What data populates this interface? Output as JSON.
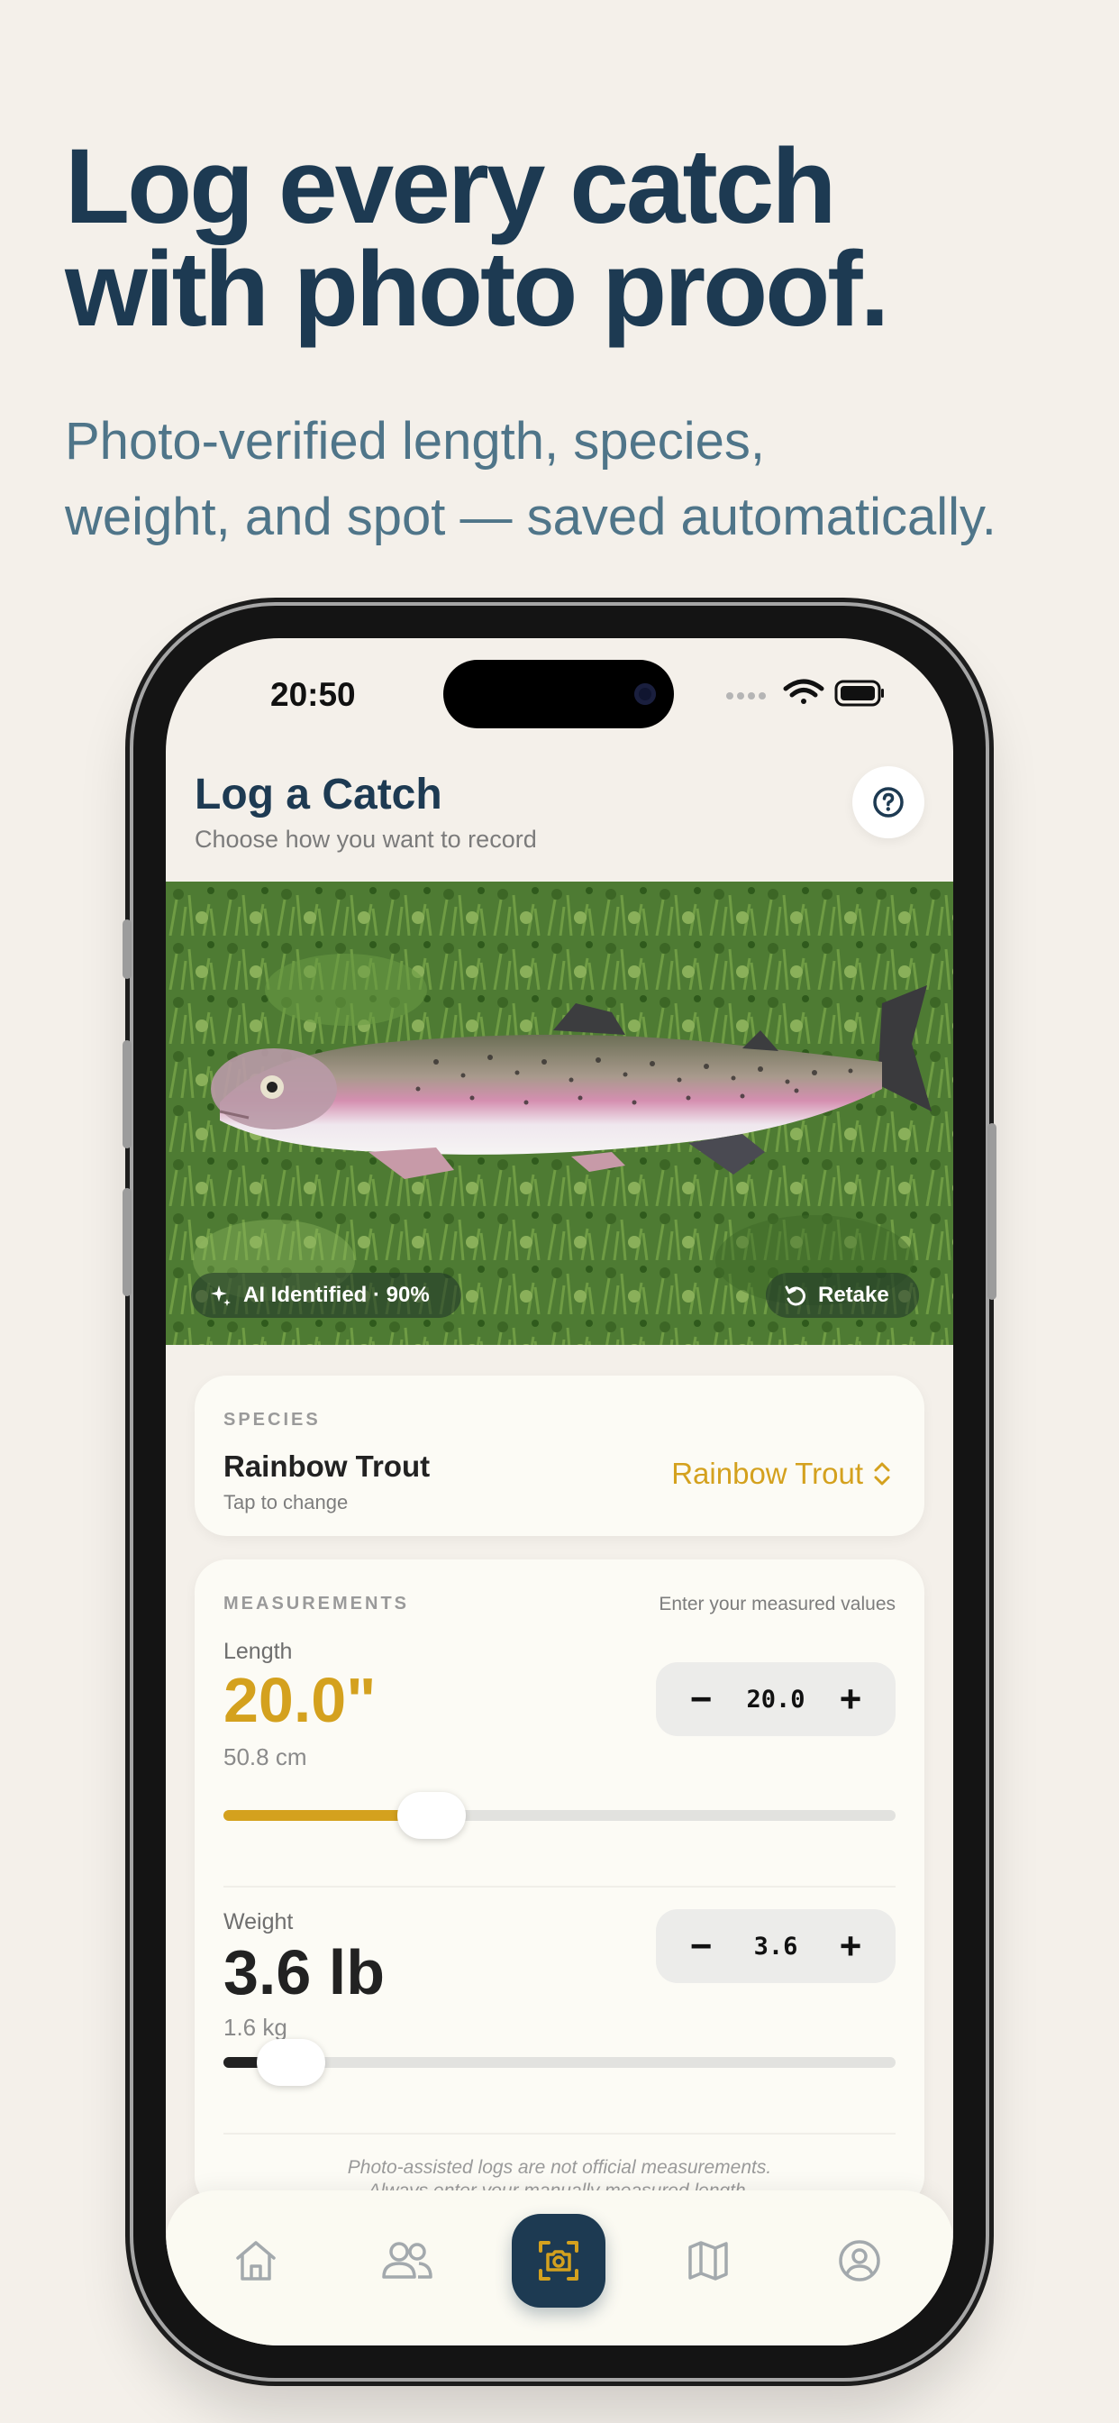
{
  "marketing": {
    "headline_line1": "Log every catch",
    "headline_line2": "with photo proof.",
    "subhead_line1": "Photo-verified length, species,",
    "subhead_line2": "weight, and spot — saved automatically."
  },
  "status_bar": {
    "time": "20:50"
  },
  "header": {
    "title": "Log a Catch",
    "subtitle": "Choose how you want to record",
    "help_icon": "question-circle-icon"
  },
  "photo": {
    "ai_badge": "AI Identified · 90%",
    "ai_icon": "sparkle-icon",
    "retake_label": "Retake",
    "retake_icon": "rotate-icon"
  },
  "species": {
    "label": "SPECIES",
    "name": "Rainbow Trout",
    "hint": "Tap to change",
    "picker_value": "Rainbow Trout"
  },
  "measurements": {
    "label": "MEASUREMENTS",
    "hint": "Enter your measured values",
    "length": {
      "label": "Length",
      "value": "20.0\"",
      "metric": "50.8 cm",
      "stepper_value": "20.0",
      "minus": "−",
      "plus": "+",
      "slider_fraction": 0.31
    },
    "weight": {
      "label": "Weight",
      "value": "3.6 lb",
      "metric": "1.6 kg",
      "stepper_value": "3.6",
      "minus": "−",
      "plus": "+",
      "slider_fraction": 0.1
    },
    "disclaimer_line1": "Photo-assisted logs are not official measurements.",
    "disclaimer_line2": "Always enter your manually measured length."
  },
  "tabbar": {
    "items": [
      "home-icon",
      "friends-icon",
      "camera-scan-icon",
      "map-icon",
      "profile-icon"
    ]
  },
  "colors": {
    "accent": "#d4a11e",
    "navy": "#1d3a52",
    "background": "#f4f0ea"
  }
}
